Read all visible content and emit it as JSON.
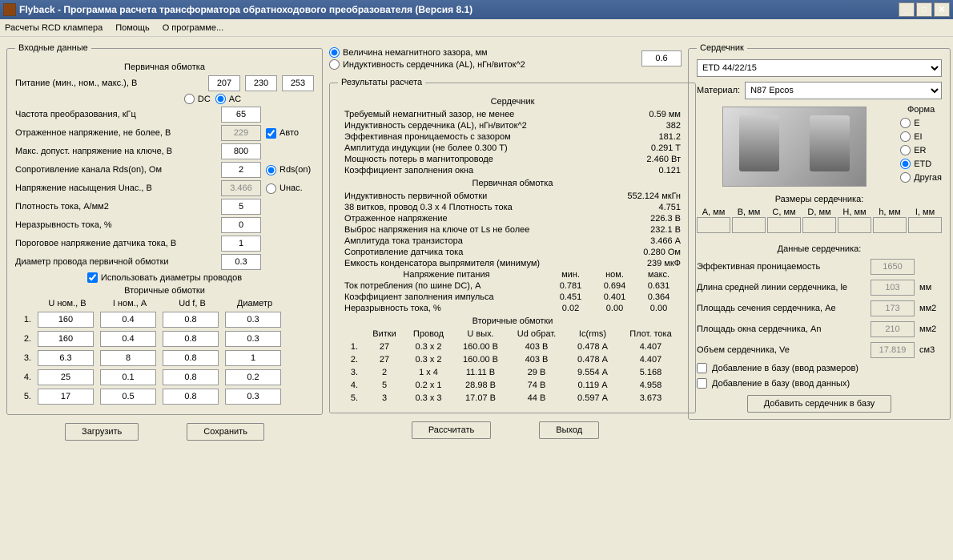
{
  "window": {
    "title": "Flyback - Программа расчета трансформатора обратноходового преобразователя (Версия 8.1)"
  },
  "menu": {
    "rcd": "Расчеты RCD клампера",
    "help": "Помощь",
    "about": "О программе..."
  },
  "input_data": {
    "legend": "Входные данные",
    "primary_title": "Первичная обмотка",
    "supply_label": "Питание (мин., ном., макс.), В",
    "supply_min": "207",
    "supply_nom": "230",
    "supply_max": "253",
    "dc": "DC",
    "ac": "AC",
    "freq_label": "Частота преобразования, кГц",
    "freq": "65",
    "refl_label": "Отраженное напряжение, не более, В",
    "refl": "229",
    "auto": "Авто",
    "maxv_label": "Макс. допуст. напряжение на ключе, В",
    "maxv": "800",
    "rds_label": "Сопротивление канала Rds(on), Ом",
    "rds": "2",
    "rds_radio": "Rds(on)",
    "unas_label": "Напряжение насыщения Uнас., В",
    "unas": "3.466",
    "unas_radio": "Uнас.",
    "j_label": "Плотность тока, А/мм2",
    "j": "5",
    "disc_label": "Неразрывность тока, %",
    "disc": "0",
    "thresh_label": "Пороговое напряжение датчика тока, В",
    "thresh": "1",
    "dwire_label": "Диаметр провода первичной обмотки",
    "dwire": "0.3",
    "use_d": "Использовать диаметры проводов",
    "sec_title": "Вторичные обмотки",
    "sec_head": {
      "u": "U ном., В",
      "i": "I ном., А",
      "uf": "Ud f, В",
      "d": "Диаметр"
    },
    "sec": [
      {
        "u": "160",
        "i": "0.4",
        "uf": "0.8",
        "d": "0.3"
      },
      {
        "u": "160",
        "i": "0.4",
        "uf": "0.8",
        "d": "0.3"
      },
      {
        "u": "6.3",
        "i": "8",
        "uf": "0.8",
        "d": "1"
      },
      {
        "u": "25",
        "i": "0.1",
        "uf": "0.8",
        "d": "0.2"
      },
      {
        "u": "17",
        "i": "0.5",
        "uf": "0.8",
        "d": "0.3"
      }
    ],
    "load_btn": "Загрузить",
    "save_btn": "Сохранить"
  },
  "gap": {
    "opt1": "Величина немагнитного зазора, мм",
    "opt2": "Индуктивность сердечника (AL), нГн/виток^2",
    "value": "0.6"
  },
  "results": {
    "legend": "Результаты расчета",
    "core_title": "Сердечник",
    "lines_core": [
      {
        "l": "Требуемый немагнитный зазор, не менее",
        "v": "0.59 мм"
      },
      {
        "l": "Индуктивность сердечника (AL), нГн/виток^2",
        "v": "382"
      },
      {
        "l": "Эффективная проницаемость с зазором",
        "v": "181.2"
      },
      {
        "l": "Амплитуда индукции            (не более 0.300 T)",
        "v": "0.291 T"
      },
      {
        "l": "Мощность потерь в магнитопроводе",
        "v": "2.460 Вт"
      },
      {
        "l": "Коэффициент заполнения окна",
        "v": "0.121"
      }
    ],
    "prim_title": "Первичная обмотка",
    "lines_prim": [
      {
        "l": "Индуктивность первичной обмотки",
        "v": "552.124 мкГн"
      },
      {
        "l": "  38 витков, провод 0.3 x 4            Плотность тока",
        "v": "4.751"
      },
      {
        "l": "Отраженное напряжение",
        "v": "226.3 В"
      },
      {
        "l": "Выброс напряжения на ключе от Ls не более",
        "v": "232.1 В"
      },
      {
        "l": "Амплитуда тока транзистора",
        "v": "3.466 А"
      },
      {
        "l": "Сопротивление датчика тока",
        "v": "0.280 Ом"
      },
      {
        "l": "Емкость конденсатора выпрямителя (минимум)",
        "v": "239 мкФ"
      }
    ],
    "supply_title": "Напряжение питания",
    "cols": {
      "min": "мин.",
      "nom": "ном.",
      "max": "макс."
    },
    "lines_3": [
      {
        "l": "Ток потребления (по шине DC), А",
        "c1": "0.781",
        "c2": "0.694",
        "c3": "0.631"
      },
      {
        "l": "Коэффициент заполнения импульса",
        "c1": "0.451",
        "c2": "0.401",
        "c3": "0.364"
      },
      {
        "l": "Неразрывность тока, %",
        "c1": "0.02",
        "c2": "0.00",
        "c3": "0.00"
      }
    ],
    "sec_title": "Вторичные обмотки",
    "sec_head": {
      "n": "",
      "turns": "Витки",
      "wire": "Провод",
      "u": "U вых.",
      "ud": "Ud обрат.",
      "ic": "Ic(rms)",
      "j": "Плот. тока"
    },
    "sec": [
      {
        "n": "1.",
        "turns": "27",
        "wire": "0.3 x 2",
        "u": "160.00 В",
        "ud": "403 В",
        "ic": "0.478 А",
        "j": "4.407"
      },
      {
        "n": "2.",
        "turns": "27",
        "wire": "0.3 x 2",
        "u": "160.00 В",
        "ud": "403 В",
        "ic": "0.478 А",
        "j": "4.407"
      },
      {
        "n": "3.",
        "turns": "2",
        "wire": "1 x 4",
        "u": "11.11 В",
        "ud": "29 В",
        "ic": "9.554 А",
        "j": "5.168"
      },
      {
        "n": "4.",
        "turns": "5",
        "wire": "0.2 x 1",
        "u": "28.98 В",
        "ud": "74 В",
        "ic": "0.119 А",
        "j": "4.958"
      },
      {
        "n": "5.",
        "turns": "3",
        "wire": "0.3 x 3",
        "u": "17.07 В",
        "ud": "44 В",
        "ic": "0.597 А",
        "j": "3.673"
      }
    ],
    "calc_btn": "Рассчитать",
    "exit_btn": "Выход"
  },
  "core": {
    "legend": "Сердечник",
    "type": "ETD 44/22/15",
    "mat_label": "Материал:",
    "material": "N87 Epcos",
    "form_label": "Форма",
    "forms": [
      "E",
      "EI",
      "ER",
      "ETD",
      "Другая"
    ],
    "dim_title": "Размеры сердечника:",
    "dim_head": [
      "A, мм",
      "B, мм",
      "C, мм",
      "D, мм",
      "H, мм",
      "h, мм",
      "I, мм"
    ],
    "data_title": "Данные сердечника:",
    "data": [
      {
        "l": "Эффективная проницаемость",
        "v": "1650",
        "u": ""
      },
      {
        "l": "Длина средней линии сердечника, le",
        "v": "103",
        "u": "мм"
      },
      {
        "l": "Площадь сечения сердечника, Ae",
        "v": "173",
        "u": "мм2"
      },
      {
        "l": "Площадь окна сердечника, An",
        "v": "210",
        "u": "мм2"
      },
      {
        "l": "Объем сердечника, Ve",
        "v": "17.819",
        "u": "см3"
      }
    ],
    "cb1": "Добавление в базу (ввод размеров)",
    "cb2": "Добавление в базу (ввод данных)",
    "add_btn": "Добавить сердечник в базу"
  }
}
